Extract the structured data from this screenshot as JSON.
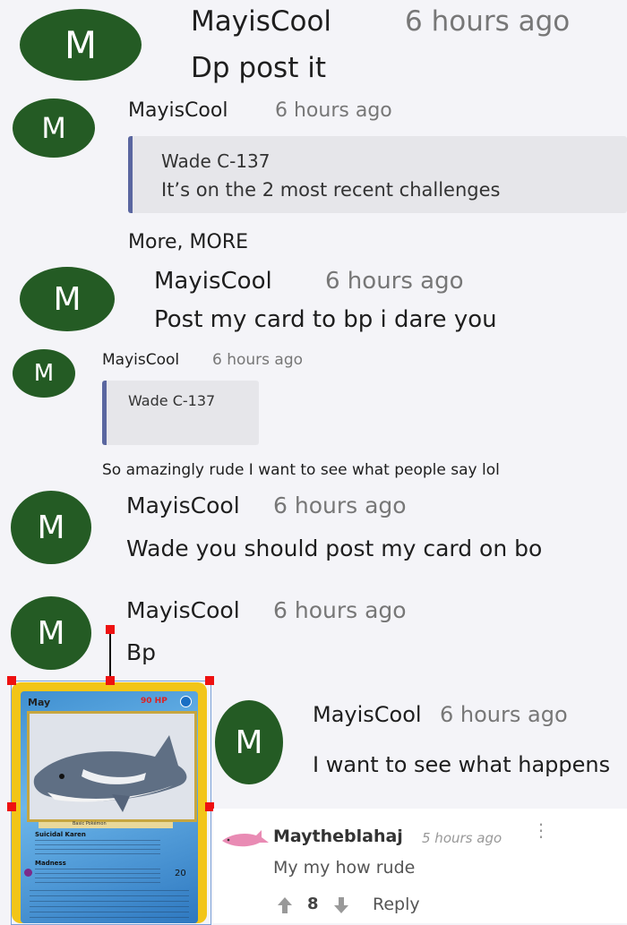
{
  "thread": [
    {
      "avatar": "M",
      "name": "MayisCool",
      "time": "6 hours ago",
      "text": "Dp post it"
    },
    {
      "avatar": "M",
      "name": "MayisCool",
      "time": "6 hours ago",
      "quote_author": "Wade C-137",
      "quote_text": "It’s on the 2 most recent challenges",
      "text": "More, MORE"
    },
    {
      "avatar": "M",
      "name": "MayisCool",
      "time": "6 hours ago",
      "text": "Post my card to bp i dare you"
    },
    {
      "avatar": "M",
      "name": "MayisCool",
      "time": "6 hours ago",
      "quote_author": "Wade C-137",
      "text": "So amazingly rude I want to see what people say lol"
    },
    {
      "avatar": "M",
      "name": "MayisCool",
      "time": "6 hours ago",
      "text": "Wade you should post my card on bo"
    },
    {
      "avatar": "M",
      "name": "MayisCool",
      "time": "6 hours ago",
      "text": "Bp"
    },
    {
      "avatar": "M",
      "name": "MayisCool",
      "time": "6 hours ago",
      "text": "I want to see what happens"
    }
  ],
  "card": {
    "name": "May",
    "hp": "90 HP",
    "stage_text": "Basic Pokémon",
    "attack1": "Suicidal Karen",
    "attack2": "Madness",
    "damage": "20"
  },
  "bottom_comment": {
    "name": "Maytheblahaj",
    "time": "5 hours ago",
    "text": "My my how rude",
    "votes": "8",
    "reply_label": "Reply"
  },
  "colors": {
    "avatar": "#245b24",
    "quote_bar": "#5a66a0",
    "selection": "#ee1111"
  }
}
